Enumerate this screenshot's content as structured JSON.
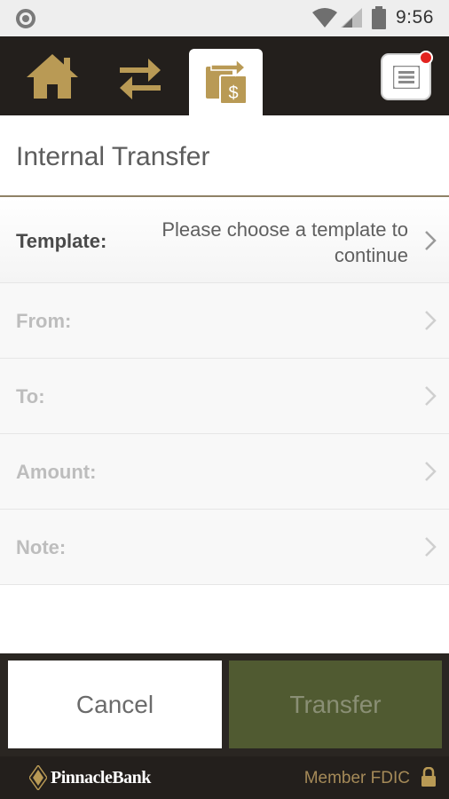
{
  "status_bar": {
    "time": "9:56"
  },
  "navbar": {
    "items": [
      {
        "icon": "home-icon"
      },
      {
        "icon": "transfers-icon"
      },
      {
        "icon": "internal-transfer-icon",
        "active": true
      }
    ],
    "menu_icon": "menu-icon",
    "notification_badge": true
  },
  "page": {
    "title": "Internal Transfer"
  },
  "form": {
    "template": {
      "label": "Template:",
      "value": "Please choose a template to continue"
    },
    "from": {
      "label": "From:"
    },
    "to": {
      "label": "To:"
    },
    "amount": {
      "label": "Amount:"
    },
    "note": {
      "label": "Note:"
    }
  },
  "actions": {
    "cancel_label": "Cancel",
    "transfer_label": "Transfer"
  },
  "footer": {
    "brand": "PinnacleBank",
    "fdic": "Member FDIC"
  },
  "colors": {
    "gold": "#b99a55",
    "dark": "#231f1c",
    "transfer_button": "#505a31",
    "badge": "#e3231f"
  }
}
